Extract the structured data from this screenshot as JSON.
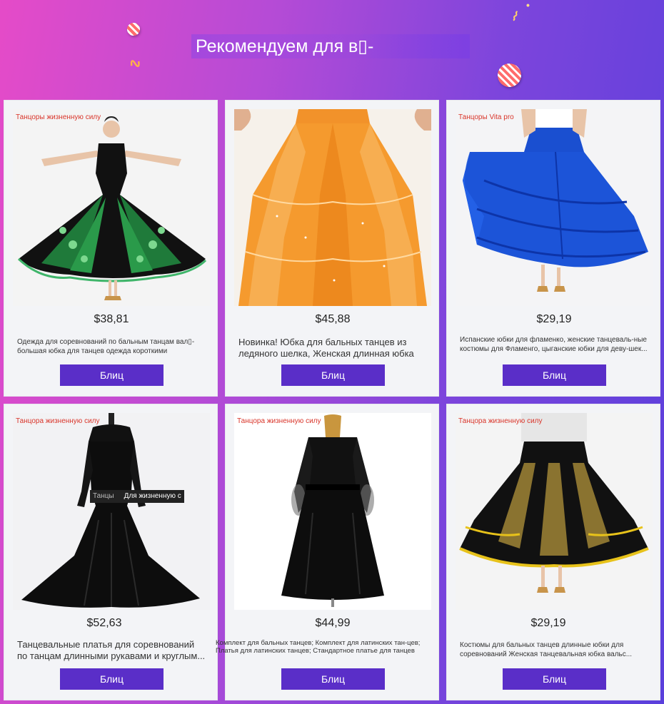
{
  "header": {
    "title": "Рекомендуем для в▯-"
  },
  "products": [
    {
      "brand": "Танцоры жизненную силу",
      "price": "$38,81",
      "description": "Одежда для соревнований по бальным танцам вал▯-большая юбка для танцев одежда короткими рукавами...",
      "button": "Блиц"
    },
    {
      "brand": "",
      "price": "$45,88",
      "description": "Новинка! Юбка для бальных танцев из ледяного шелка, Женская длинная юбка",
      "button": "Блиц"
    },
    {
      "brand": "Танцоры Vita pro",
      "price": "$29,19",
      "description": "Испанские юбки для фламенко, женские танцеваль-ные костюмы для Фламенго, цыганские юбки для деву-шек...",
      "button": "Блиц"
    },
    {
      "brand": "Танцора жизненную силу",
      "price": "$52,63",
      "description": "Танцевальные платья для соревнований по танцам длинными рукавами и круглым...",
      "button": "Блиц",
      "overlay_muted": "Танцы",
      "overlay_text": "Для жизненную с"
    },
    {
      "brand": "Танцора жизненную силу",
      "price": "$44,99",
      "description": "Комплект для бальных танцев; Комплект для латинских тан-цев; Платья для латинских танцев; Стандартное платье для танцев",
      "button": "Блиц"
    },
    {
      "brand": "Танцора жизненную силу",
      "price": "$29,19",
      "description": "Костюмы для бальных танцев длинные юбки для соревнований Женская танцевальная юбка вальс...",
      "button": "Блиц"
    }
  ],
  "colors": {
    "button": "#5a2ec8",
    "brand_text": "#d9352a",
    "card_bg": "#f3f4f7"
  }
}
